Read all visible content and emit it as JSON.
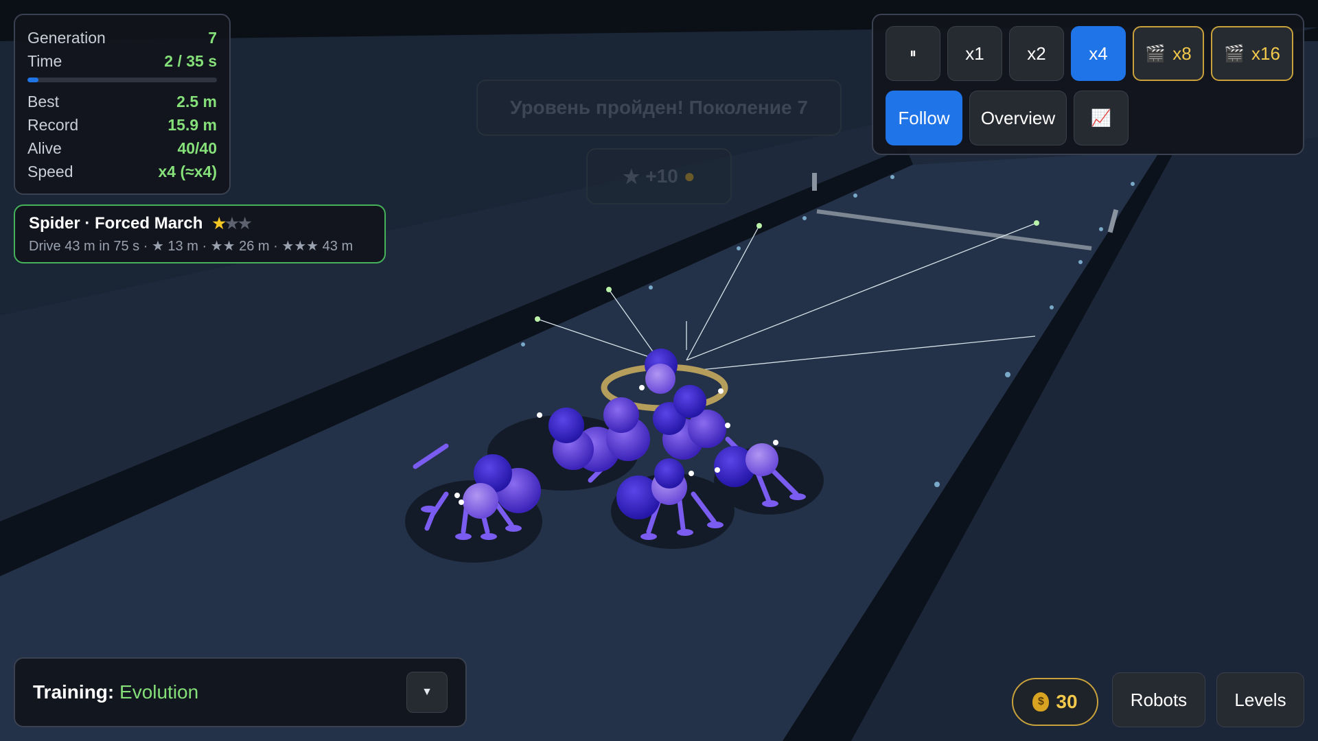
{
  "stats": {
    "generation_label": "Generation",
    "generation_value": "7",
    "time_label": "Time",
    "time_value": "2 / 35 s",
    "time_progress": 0.057,
    "best_label": "Best",
    "best_value": "2.5 m",
    "record_label": "Record",
    "record_value": "15.9 m",
    "alive_label": "Alive",
    "alive_value": "40/40",
    "speed_label": "Speed",
    "speed_value": "x4 (≈x4)"
  },
  "level": {
    "title": "Spider · Forced March",
    "stars_earned": 1,
    "stars_total": 3,
    "description": "Drive 43 m in 75 s · ★ 13 m · ★★ 26 m · ★★★ 43 m"
  },
  "controls": {
    "pause_label": "⏸",
    "x1_label": "x1",
    "x2_label": "x2",
    "x4_label": "x4",
    "x8_label": "x8",
    "x16_label": "x16",
    "active_speed": "x4",
    "follow_label": "Follow",
    "overview_label": "Overview",
    "chart_icon": "📈"
  },
  "banner": {
    "text": "Уровень пройден! Поколение 7",
    "reward_star": "★",
    "reward_text": "+10",
    "reward_icon": "coin-icon"
  },
  "training": {
    "label": "Training:",
    "mode": "Evolution",
    "dropdown_icon": "▼"
  },
  "bottom_right": {
    "coins": "30",
    "robots_label": "Robots",
    "levels_label": "Levels"
  },
  "colors": {
    "accent_blue": "#1f74e8",
    "value_green": "#86e07a",
    "gold": "#f3c94c",
    "panel_bg": "#11141b"
  }
}
